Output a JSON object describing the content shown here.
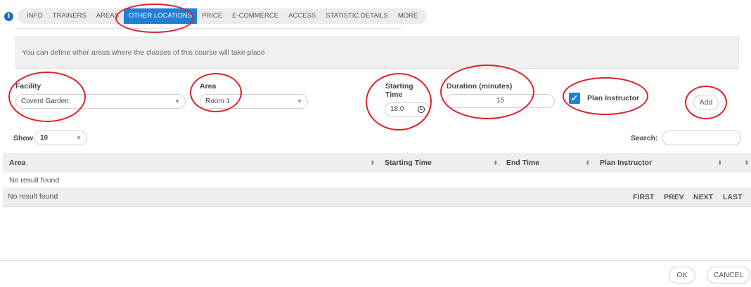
{
  "tabs": [
    {
      "label": "INFO"
    },
    {
      "label": "TRAINERS"
    },
    {
      "label": "AREAS"
    },
    {
      "label": "OTHER LOCATIONS"
    },
    {
      "label": "PRICE"
    },
    {
      "label": "E-COMMERCE"
    },
    {
      "label": "ACCESS"
    },
    {
      "label": "STATISTIC DETAILS"
    },
    {
      "label": "MORE"
    }
  ],
  "active_tab": "OTHER LOCATIONS",
  "info_icon": "i",
  "info_message": "You can define other areas where the classes of this course will take place",
  "form": {
    "facility_label": "Facility",
    "facility_value": "Covent Garden",
    "area_label": "Area",
    "area_value": "Room 1",
    "starting_time_label": "Starting Time",
    "starting_time_value": "18:0",
    "duration_label": "Duration (minutes)",
    "duration_value": "15",
    "plan_instructor_label": "Plan Instructor",
    "plan_instructor_checked": true,
    "add_label": "Add"
  },
  "table_controls": {
    "show_label": "Show",
    "show_value": "10",
    "search_label": "Search:",
    "search_value": ""
  },
  "table": {
    "columns": [
      "Area",
      "Starting Time",
      "End Time",
      "Plan Instructor"
    ],
    "empty_message": "No result found",
    "footer_message": "No result found",
    "pagination": [
      "FIRST",
      "PREV",
      "NEXT",
      "LAST"
    ]
  },
  "footer": {
    "ok_label": "OK",
    "cancel_label": "CANCEL"
  },
  "colors": {
    "accent": "#1f7fd6",
    "annotation": "#e0202a"
  }
}
